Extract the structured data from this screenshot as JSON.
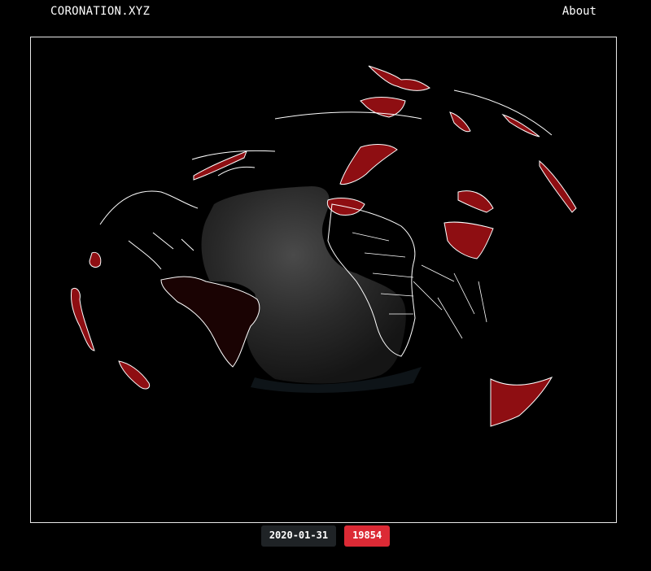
{
  "header": {
    "brand": "CORONATION.XYZ",
    "about_label": "About"
  },
  "map": {
    "ocean_color": "#2b2b2b",
    "affected_color": "#8e0e12",
    "low_color": "#1a0303",
    "border_color": "#ffffff"
  },
  "footer": {
    "date": "2020-01-31",
    "count": "19854"
  }
}
